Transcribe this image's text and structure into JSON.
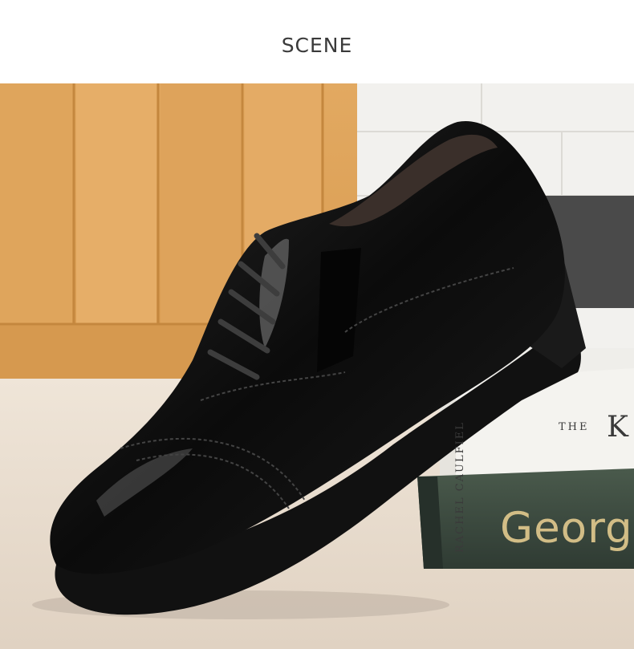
{
  "header": {
    "title": "SCENE"
  },
  "scene": {
    "description_icon": "dress-shoe-icon",
    "book_spine_author": "RACHEL CAULFIEL",
    "book_cover_small": "THE",
    "book_cover_letter": "K",
    "book_green_title": "Georgi"
  },
  "colors": {
    "wood": "#d9a05a",
    "wall": "#efefec",
    "table": "#e7dacb",
    "shoe": "#0d0d0d",
    "book_green": "#3d4a40",
    "gold_text": "#d2bd86"
  }
}
